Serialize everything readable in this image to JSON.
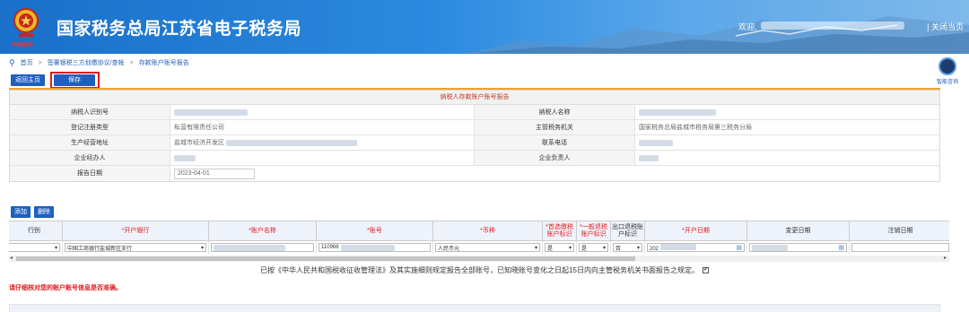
{
  "header": {
    "title": "国家税务总局江苏省电子税务局",
    "welcome": "欢迎,",
    "close_page": "| 关闭当页",
    "emblem_sub": "中国税务"
  },
  "breadcrumb": {
    "items": [
      "首页",
      "签署银税三方划缴协议/查帐",
      "存款账户账号报告"
    ],
    "separator": ">"
  },
  "assistant": {
    "label": "智能咨询"
  },
  "toolbar": {
    "back_label": "返回主页",
    "save_label": "保存"
  },
  "report": {
    "title": "纳税人存款账户账号报告",
    "rows": [
      {
        "label_left": "纳税人识别号",
        "value_left": "",
        "label_right": "纳税人名称",
        "value_right": ""
      },
      {
        "label_left": "登记注册类型",
        "value_left": "私营有限责任公司",
        "label_right": "主管税务机关",
        "value_right": "国家税务总局盐城市税务局第三税务分局"
      },
      {
        "label_left": "生产经营地址",
        "value_left": "盐城市经济开发区",
        "label_right": "联系电话",
        "value_right": ""
      },
      {
        "label_left": "企业经办人",
        "value_left": "",
        "label_right": "企业负责人",
        "value_right": ""
      },
      {
        "label_left": "报告日期",
        "value_left": "2023-04-01"
      }
    ]
  },
  "buttons": {
    "add": "添加",
    "delete": "删除"
  },
  "table": {
    "headers": {
      "type": "行别",
      "bank": "*开户银行",
      "account_name": "*账户名称",
      "account_no": "*账号",
      "currency": "*币种",
      "preferred_tax_flag": "*首选缴税账户标识",
      "general_tax_flag": "*一般退税账户标识",
      "export_tax_flag": "出口退税账户标识",
      "open_date": "*开户日期",
      "change_date": "变更日期",
      "cancel_date": "注销日期"
    },
    "row": {
      "type": "",
      "bank": "中国工商银行盐城新区支行",
      "account_name": "",
      "account_no": "110966",
      "currency": "人民币元",
      "preferred_tax_flag": "是",
      "general_tax_flag": "是",
      "export_tax_flag": "否",
      "open_date": "202",
      "change_date": "",
      "cancel_date": ""
    }
  },
  "declaration": "已按《中华人民共和国税收征收管理法》及其实施细则规定报告全部账号，已知晓账号变化之日起15日内向主管税务机关书面报告之规定。",
  "declaration_checked": "✔",
  "warning": "请仔细核对您的账户账号信息是否准确。",
  "colors": {
    "header_blue": "#1a6fc9",
    "button_blue": "#1f5fbf",
    "warning_red": "#e21a1a",
    "accent_orange": "#f0a030"
  }
}
